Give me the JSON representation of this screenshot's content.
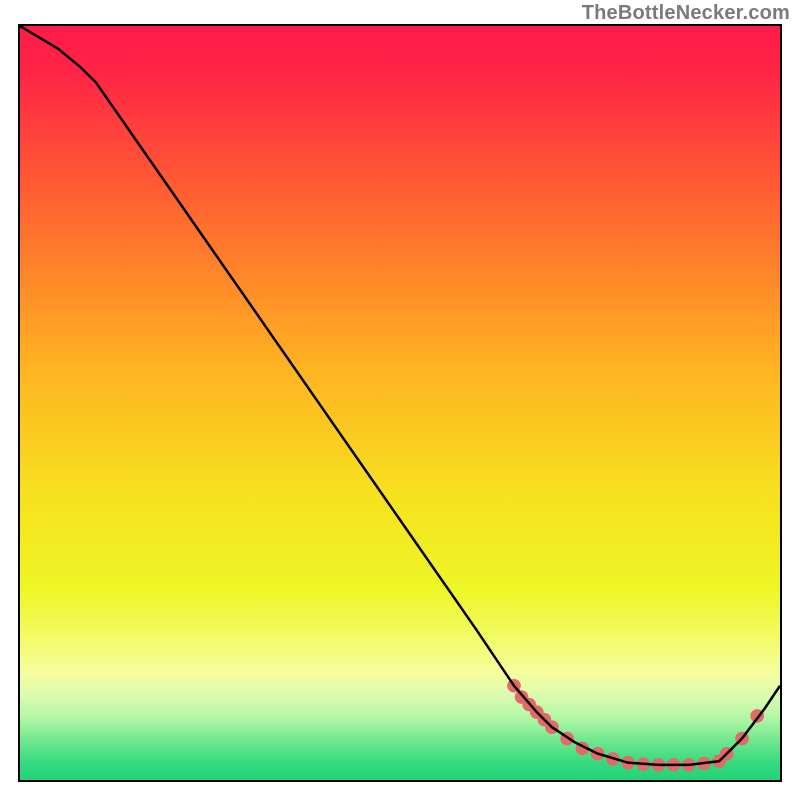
{
  "watermark": "TheBottleNecker.com",
  "chart_data": {
    "type": "line",
    "title": "",
    "xlabel": "",
    "ylabel": "",
    "xlim": [
      0,
      100
    ],
    "ylim": [
      0,
      100
    ],
    "grid": false,
    "legend": false,
    "gradient_stops": [
      {
        "offset": 0.0,
        "color": "#ff1b4b"
      },
      {
        "offset": 0.06,
        "color": "#ff2446"
      },
      {
        "offset": 0.25,
        "color": "#ff6a2f"
      },
      {
        "offset": 0.45,
        "color": "#ffb322"
      },
      {
        "offset": 0.62,
        "color": "#f6e21f"
      },
      {
        "offset": 0.74,
        "color": "#eef626"
      },
      {
        "offset": 0.8,
        "color": "#f2fb60"
      },
      {
        "offset": 0.85,
        "color": "#f7fe9e"
      },
      {
        "offset": 0.88,
        "color": "#dcfcb0"
      },
      {
        "offset": 0.91,
        "color": "#b3f7a6"
      },
      {
        "offset": 0.94,
        "color": "#6fe88e"
      },
      {
        "offset": 0.97,
        "color": "#34d97e"
      },
      {
        "offset": 1.0,
        "color": "#1fd176"
      }
    ],
    "series": [
      {
        "name": "bottleneck-curve",
        "color": "#000000",
        "x": [
          0,
          5,
          8,
          10,
          20,
          30,
          40,
          50,
          60,
          65,
          68,
          70,
          73,
          76,
          80,
          84,
          88,
          92,
          95,
          98,
          100
        ],
        "y": [
          100,
          97,
          94.5,
          92.5,
          78,
          63.5,
          49,
          34.5,
          20,
          12.5,
          9,
          7,
          5,
          3.5,
          2.3,
          2,
          2,
          2.5,
          5.5,
          9.5,
          12.5
        ]
      },
      {
        "name": "highlight-dots",
        "type": "scatter",
        "color": "#e46a6a",
        "x": [
          65,
          66,
          67,
          68,
          69,
          70,
          72,
          74,
          76,
          78,
          80,
          82,
          84,
          86,
          88,
          90,
          92,
          93,
          95,
          97
        ],
        "y": [
          12.5,
          11,
          10,
          9,
          8,
          7,
          5.5,
          4.2,
          3.5,
          2.8,
          2.3,
          2.1,
          2.0,
          2.0,
          2.0,
          2.2,
          2.5,
          3.5,
          5.5,
          8.5
        ]
      }
    ]
  }
}
